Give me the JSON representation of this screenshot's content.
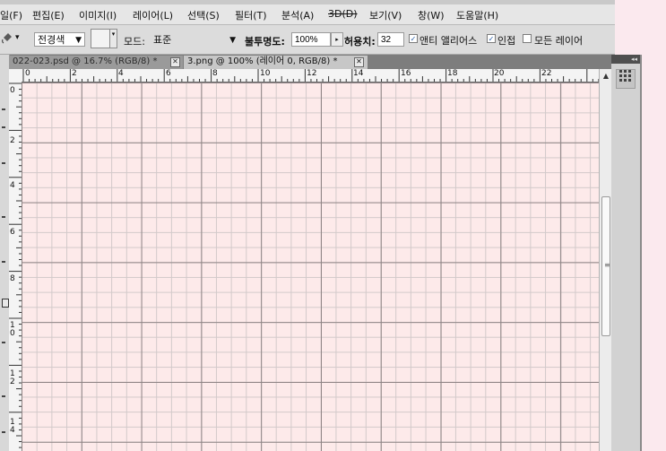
{
  "menu": {
    "items": [
      "일(F)",
      "편집(E)",
      "이미지(I)",
      "레이어(L)",
      "선택(S)",
      "필터(T)",
      "분석(A)",
      "3D(D)",
      "보기(V)",
      "창(W)",
      "도움말(H)"
    ]
  },
  "options": {
    "tool_arrow": "▾",
    "source_dropdown": "전경색",
    "mode_label": "모드:",
    "mode_value": "표준",
    "opacity_label": "불투명도:",
    "opacity_value": "100%",
    "tolerance_label": "허용치:",
    "tolerance_value": "32",
    "antialias_label": "앤티 앨리어스",
    "antialias_checked": true,
    "contiguous_label": "인접",
    "contiguous_checked": true,
    "all_layers_label": "모든 레이어",
    "all_layers_checked": false
  },
  "tabs": [
    {
      "label": "022-023.psd @ 16.7% (RGB/8) *",
      "active": false
    },
    {
      "label": "3.png @ 100% (레이어 0, RGB/8) *",
      "active": true
    }
  ],
  "rulers": {
    "horizontal": [
      "0",
      "2",
      "4",
      "6",
      "8",
      "10",
      "12",
      "14",
      "16",
      "18",
      "20",
      "22"
    ],
    "vertical": [
      "0",
      "2",
      "4",
      "6",
      "8",
      "1 0",
      "1 2",
      "1 4"
    ]
  },
  "dock": {
    "collapse_glyph": "◂◂",
    "panel_icon": "grid-icon"
  },
  "colors": {
    "canvas_bg": "#fdeaea",
    "grid_major": "#8e8384",
    "grid_minor": "#d2c9ca"
  }
}
